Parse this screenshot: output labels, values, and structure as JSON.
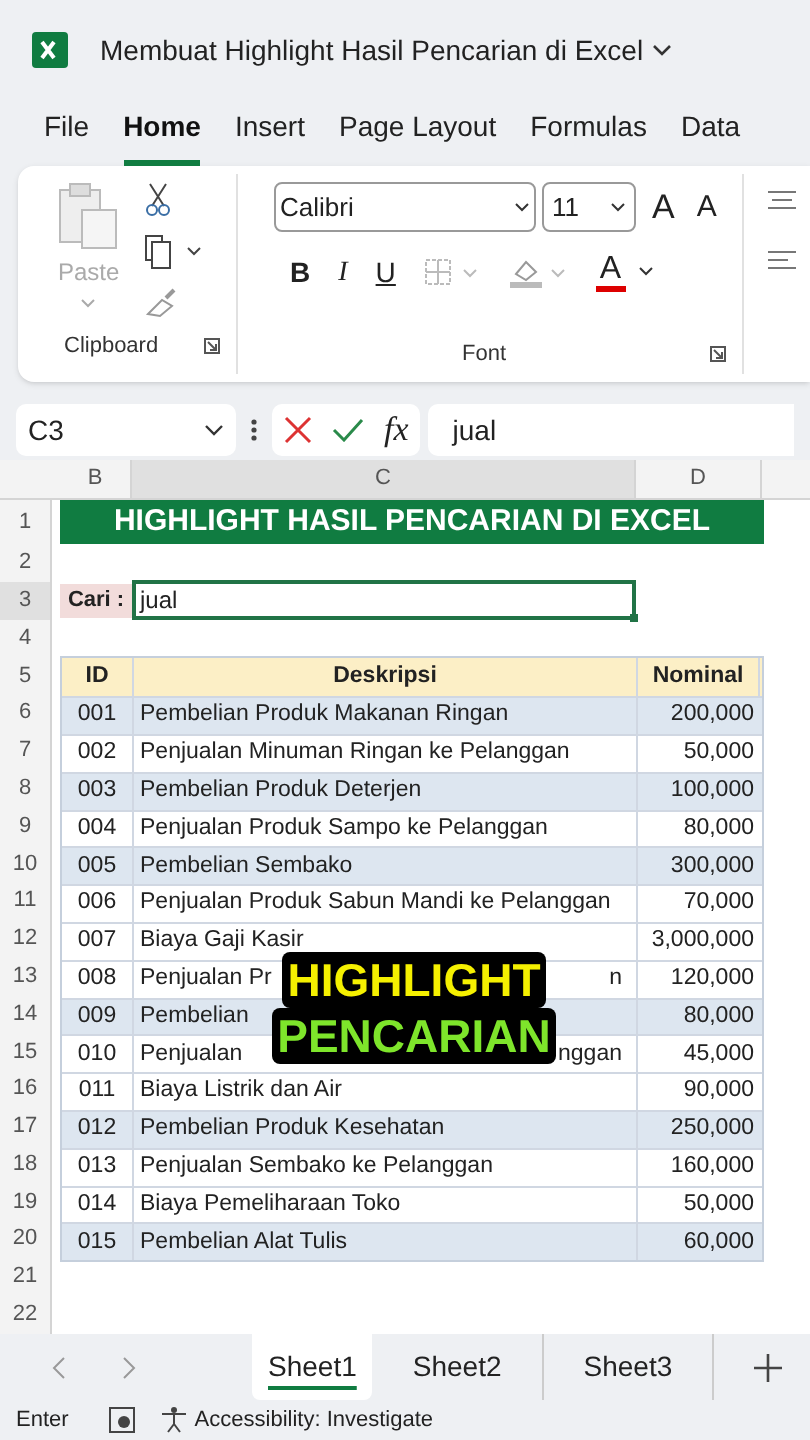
{
  "window": {
    "title": "Membuat Highlight Hasil Pencarian di Excel"
  },
  "tabs": [
    {
      "label": "File",
      "selected": false
    },
    {
      "label": "Home",
      "selected": true
    },
    {
      "label": "Insert",
      "selected": false
    },
    {
      "label": "Page Layout",
      "selected": false
    },
    {
      "label": "Formulas",
      "selected": false
    },
    {
      "label": "Data",
      "selected": false
    }
  ],
  "ribbon": {
    "clipboard": {
      "paste_label": "Paste",
      "group_label": "Clipboard"
    },
    "font": {
      "font_name": "Calibri",
      "font_size": "11",
      "grow": "A",
      "shrink": "A",
      "bold": "B",
      "italic": "I",
      "underline": "U",
      "font_color": "A",
      "group_label": "Font"
    }
  },
  "formula_bar": {
    "name_box": "C3",
    "fx": "fx",
    "value": "jual"
  },
  "columns": [
    "B",
    "C",
    "D"
  ],
  "row_numbers": [
    "1",
    "2",
    "3",
    "4",
    "5",
    "6",
    "7",
    "8",
    "9",
    "10",
    "11",
    "12",
    "13",
    "14",
    "15",
    "16",
    "17",
    "18",
    "19",
    "20",
    "21",
    "22"
  ],
  "sheet": {
    "title": "HIGHLIGHT HASIL PENCARIAN DI EXCEL",
    "search_label": "Cari :",
    "search_value": "jual",
    "headers": [
      "ID",
      "Deskripsi",
      "Nominal"
    ],
    "rows": [
      {
        "id": "001",
        "desc": "Pembelian Produk Makanan Ringan",
        "nominal": "200,000",
        "highlighted": true
      },
      {
        "id": "002",
        "desc": "Penjualan Minuman Ringan ke Pelanggan",
        "nominal": "50,000",
        "highlighted": false
      },
      {
        "id": "003",
        "desc": "Pembelian Produk Deterjen",
        "nominal": "100,000",
        "highlighted": true
      },
      {
        "id": "004",
        "desc": "Penjualan Produk Sampo ke Pelanggan",
        "nominal": "80,000",
        "highlighted": false
      },
      {
        "id": "005",
        "desc": "Pembelian Sembako",
        "nominal": "300,000",
        "highlighted": true
      },
      {
        "id": "006",
        "desc": "Penjualan Produk Sabun Mandi ke Pelanggan",
        "nominal": "70,000",
        "highlighted": false
      },
      {
        "id": "007",
        "desc": "Biaya Gaji Kasir",
        "nominal": "3,000,000",
        "highlighted": false
      },
      {
        "id": "008",
        "desc": "Penjualan Pr",
        "desc_tail": "n",
        "nominal": "120,000",
        "highlighted": false
      },
      {
        "id": "009",
        "desc": "Pembelian",
        "nominal": "80,000",
        "highlighted": true
      },
      {
        "id": "010",
        "desc": "Penjualan",
        "desc_tail": "nggan",
        "nominal": "45,000",
        "highlighted": false
      },
      {
        "id": "011",
        "desc": "Biaya Listrik dan Air",
        "nominal": "90,000",
        "highlighted": false
      },
      {
        "id": "012",
        "desc": "Pembelian Produk Kesehatan",
        "nominal": "250,000",
        "highlighted": true
      },
      {
        "id": "013",
        "desc": "Penjualan Sembako ke Pelanggan",
        "nominal": "160,000",
        "highlighted": false
      },
      {
        "id": "014",
        "desc": "Biaya Pemeliharaan Toko",
        "nominal": "50,000",
        "highlighted": false
      },
      {
        "id": "015",
        "desc": "Pembelian Alat Tulis",
        "nominal": "60,000",
        "highlighted": true
      }
    ]
  },
  "caption": [
    {
      "text": "HIGHLIGHT",
      "kind": "primary"
    },
    {
      "text": "PENCARIAN",
      "kind": "secondary"
    }
  ],
  "sheet_tabs": [
    {
      "label": "Sheet1",
      "selected": true
    },
    {
      "label": "Sheet2",
      "selected": false
    },
    {
      "label": "Sheet3",
      "selected": false
    }
  ],
  "status_bar": {
    "mode": "Enter",
    "accessibility": "Accessibility: Investigate"
  }
}
